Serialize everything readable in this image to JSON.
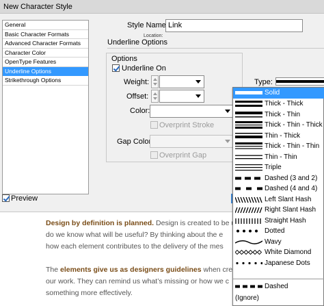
{
  "window": {
    "title": "New Character Style"
  },
  "categories": [
    {
      "label": "General",
      "selected": false
    },
    {
      "label": "Basic Character Formats",
      "selected": false
    },
    {
      "label": "Advanced Character Formats",
      "selected": false
    },
    {
      "label": "Character Color",
      "selected": false
    },
    {
      "label": "OpenType Features",
      "selected": false
    },
    {
      "label": "Underline Options",
      "selected": true
    },
    {
      "label": "Strikethrough Options",
      "selected": false
    }
  ],
  "style_name": {
    "label": "Style Name:",
    "value": "Link"
  },
  "location": {
    "label": "Location:"
  },
  "section": {
    "title": "Underline Options"
  },
  "options": {
    "title": "Options",
    "underline_on": {
      "label": "Underline On",
      "checked": true
    },
    "weight_label": "Weight:",
    "offset_label": "Offset:",
    "type_label": "Type:",
    "color_label": "Color:",
    "overprint_stroke_label": "Overprint Stroke",
    "gap_color_label": "Gap Color:",
    "overprint_gap_label": "Overprint Gap"
  },
  "preview": {
    "label": "Preview",
    "checked": true
  },
  "type_options": [
    {
      "label": "Solid",
      "icon": "solid-line-icon",
      "selected": true
    },
    {
      "label": "Thick - Thick",
      "icon": "thick-thick-icon"
    },
    {
      "label": "Thick - Thin",
      "icon": "thick-thin-icon"
    },
    {
      "label": "Thick - Thin - Thick",
      "icon": "thick-thin-thick-icon"
    },
    {
      "label": "Thin - Thick",
      "icon": "thin-thick-icon"
    },
    {
      "label": "Thick - Thin - Thin",
      "icon": "thick-thin-thin-icon"
    },
    {
      "label": "Thin - Thin",
      "icon": "thin-thin-icon"
    },
    {
      "label": "Triple",
      "icon": "triple-line-icon"
    },
    {
      "label": "Dashed (3 and 2)",
      "icon": "dashed-3-2-icon"
    },
    {
      "label": "Dashed (4 and 4)",
      "icon": "dashed-4-4-icon"
    },
    {
      "label": "Left Slant Hash",
      "icon": "left-slant-hash-icon"
    },
    {
      "label": "Right Slant Hash",
      "icon": "right-slant-hash-icon"
    },
    {
      "label": "Straight Hash",
      "icon": "straight-hash-icon"
    },
    {
      "label": "Dotted",
      "icon": "dotted-line-icon"
    },
    {
      "label": "Wavy",
      "icon": "wavy-line-icon"
    },
    {
      "label": "White Diamond",
      "icon": "white-diamond-icon"
    },
    {
      "label": "Japanese Dots",
      "icon": "japanese-dots-icon"
    },
    {
      "label": "",
      "icon": "blank-line-icon"
    },
    {
      "label": "Dashed",
      "icon": "dashed-line-icon"
    },
    {
      "label": "(Ignore)",
      "icon": ""
    }
  ],
  "article": {
    "p1_bold": "Design by definition is planned.",
    "p1_line1": " Design is created to be u",
    "p1_line2": "do we know what will be useful? By thinking about the e",
    "p1_line3": "how each element contributes to the delivery of the mes",
    "p2_text1": "The ",
    "p2_bold": "elements give us as designers guidelines",
    "p2_text2": " when creat",
    "p2_line2": "our work. They can remind us what’s missing or how we c",
    "p2_line3": "something more effectively."
  },
  "colors": {
    "selection": "#3399ff",
    "accent_text": "#7a4d18"
  }
}
